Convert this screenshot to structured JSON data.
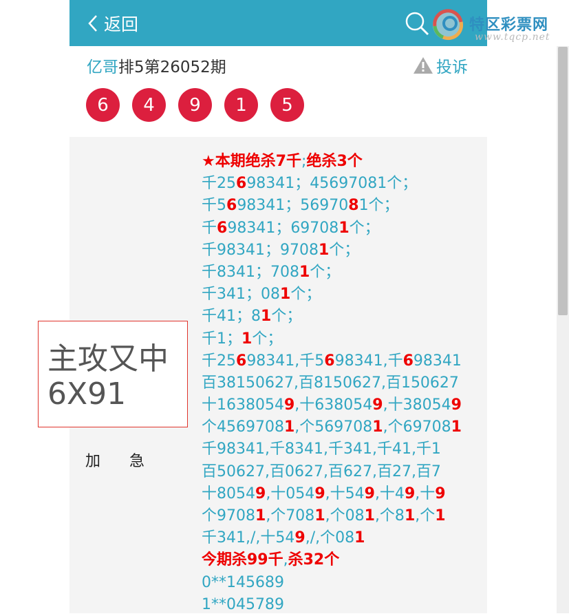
{
  "header": {
    "back_label": "返回"
  },
  "logo": {
    "title": "特区彩票网",
    "url": "www.tqcp.net"
  },
  "title_row": {
    "author": "亿哥",
    "title": "排5第26052期",
    "complain_label": "投诉"
  },
  "balls": [
    "6",
    "4",
    "9",
    "1",
    "5"
  ],
  "promo": {
    "line1": "主攻又中",
    "line2": "6X91"
  },
  "urgent": "加急",
  "lines": [
    [
      [
        "r",
        "★本期绝杀7千"
      ],
      [
        "n",
        ";"
      ],
      [
        "r",
        "绝杀3个"
      ]
    ],
    [
      [
        "n",
        "千25"
      ],
      [
        "r",
        "6"
      ],
      [
        "n",
        "98341；45697081个；"
      ]
    ],
    [
      [
        "n",
        "千5"
      ],
      [
        "r",
        "6"
      ],
      [
        "n",
        "98341；56970"
      ],
      [
        "r",
        "8"
      ],
      [
        "n",
        "1个；"
      ]
    ],
    [
      [
        "n",
        "千"
      ],
      [
        "r",
        "6"
      ],
      [
        "n",
        "98341；69708"
      ],
      [
        "r",
        "1"
      ],
      [
        "n",
        "个；"
      ]
    ],
    [
      [
        "n",
        "千98341；9708"
      ],
      [
        "r",
        "1"
      ],
      [
        "n",
        "个；"
      ]
    ],
    [
      [
        "n",
        "千8341；708"
      ],
      [
        "r",
        "1"
      ],
      [
        "n",
        "个；"
      ]
    ],
    [
      [
        "n",
        "千341；08"
      ],
      [
        "r",
        "1"
      ],
      [
        "n",
        "个；"
      ]
    ],
    [
      [
        "n",
        "千41；8"
      ],
      [
        "r",
        "1"
      ],
      [
        "n",
        "个；"
      ]
    ],
    [
      [
        "n",
        "千1；"
      ],
      [
        "r",
        "1"
      ],
      [
        "n",
        "个；"
      ]
    ],
    [
      [
        "n",
        "千25"
      ],
      [
        "r",
        "6"
      ],
      [
        "n",
        "98341,千5"
      ],
      [
        "r",
        "6"
      ],
      [
        "n",
        "98341,千"
      ],
      [
        "r",
        "6"
      ],
      [
        "n",
        "98341"
      ]
    ],
    [
      [
        "n",
        "百38150627,百8150627,百150627"
      ]
    ],
    [
      [
        "n",
        "十1638054"
      ],
      [
        "r",
        "9"
      ],
      [
        "n",
        ",十638054"
      ],
      [
        "r",
        "9"
      ],
      [
        "n",
        ",十38054"
      ],
      [
        "r",
        "9"
      ]
    ],
    [
      [
        "n",
        "个4569708"
      ],
      [
        "r",
        "1"
      ],
      [
        "n",
        ",个569708"
      ],
      [
        "r",
        "1"
      ],
      [
        "n",
        ",个69708"
      ],
      [
        "r",
        "1"
      ]
    ],
    [
      [
        "n",
        "千98341,千8341,千341,千41,千1"
      ]
    ],
    [
      [
        "n",
        "百50627,百0627,百627,百27,百7"
      ]
    ],
    [
      [
        "n",
        "十8054"
      ],
      [
        "r",
        "9"
      ],
      [
        "n",
        ",十054"
      ],
      [
        "r",
        "9"
      ],
      [
        "n",
        ",十54"
      ],
      [
        "r",
        "9"
      ],
      [
        "n",
        ",十4"
      ],
      [
        "r",
        "9"
      ],
      [
        "n",
        ",十"
      ],
      [
        "r",
        "9"
      ]
    ],
    [
      [
        "n",
        "个9708"
      ],
      [
        "r",
        "1"
      ],
      [
        "n",
        ",个708"
      ],
      [
        "r",
        "1"
      ],
      [
        "n",
        ",个08"
      ],
      [
        "r",
        "1"
      ],
      [
        "n",
        ",个8"
      ],
      [
        "r",
        "1"
      ],
      [
        "n",
        ",个"
      ],
      [
        "r",
        "1"
      ]
    ],
    [
      [
        "n",
        "千341,/,十54"
      ],
      [
        "r",
        "9"
      ],
      [
        "n",
        ",/,个08"
      ],
      [
        "r",
        "1"
      ]
    ],
    [
      [
        "r",
        "今期杀99千"
      ],
      [
        "n",
        ","
      ],
      [
        "r",
        "杀32个"
      ]
    ],
    [
      [
        "n",
        "0**145689"
      ]
    ],
    [
      [
        "n",
        "1**045789"
      ]
    ]
  ],
  "colors": {
    "header": "#31a6c2",
    "ball": "#dc1f3e",
    "highlight": "#e00000"
  }
}
